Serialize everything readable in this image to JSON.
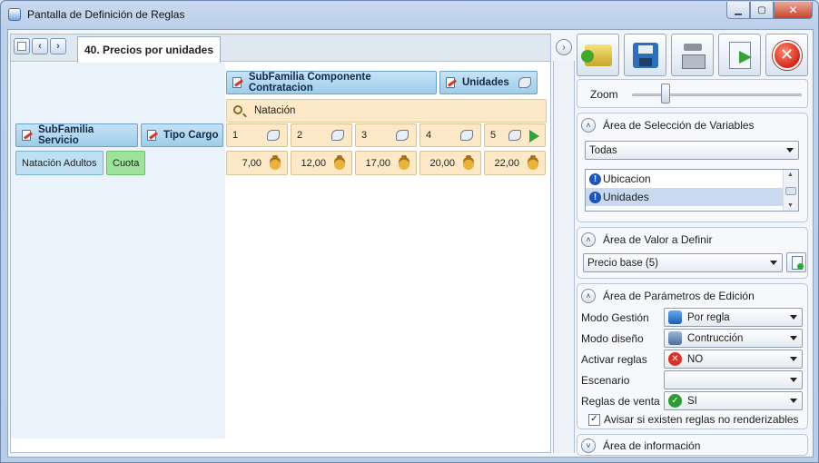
{
  "window": {
    "title": "Pantalla de Definición de Reglas",
    "controls": {
      "minimize": "▁",
      "maximize": "▢",
      "close": "✕"
    }
  },
  "tabs": {
    "nav_prev": "‹",
    "nav_next": "›",
    "active_tab": "40. Precios por unidades"
  },
  "grid": {
    "column_headers": [
      {
        "label": "SubFamilia Componente Contratacion"
      },
      {
        "label": "Unidades"
      }
    ],
    "row_headers": [
      {
        "label": "SubFamilia Servicio"
      },
      {
        "label": "Tipo Cargo"
      }
    ],
    "filter_value": "Natación",
    "units": [
      "1",
      "2",
      "3",
      "4",
      "5"
    ],
    "prices": [
      "7,00",
      "12,00",
      "17,00",
      "20,00",
      "22,00"
    ],
    "row_values": [
      "Natación Adultos",
      "Cuota"
    ]
  },
  "splitter": {
    "collapse_glyph": "›"
  },
  "toolbar": {
    "buttons": [
      "open-icon",
      "save-icon",
      "press-icon",
      "export-icon",
      "cancel-icon"
    ],
    "cancel_glyph": "✕"
  },
  "zoom": {
    "label": "Zoom",
    "level": 0.18
  },
  "variables_section": {
    "title": "Área de Selección de Variables",
    "chevron": "˄",
    "filter_selected": "Todas",
    "items": [
      {
        "label": "Ubicacion",
        "selected": false
      },
      {
        "label": "Unidades",
        "selected": true
      }
    ]
  },
  "value_section": {
    "title": "Área de Valor a Definir",
    "chevron": "˄",
    "selected": "Precio base (5)"
  },
  "params_section": {
    "title": "Área de Parámetros de Edición",
    "chevron": "˄",
    "rows": [
      {
        "label": "Modo Gestión",
        "value": "Por regla",
        "icon": "book-icon"
      },
      {
        "label": "Modo diseño",
        "value": "Contrucción",
        "icon": "gear-icon"
      },
      {
        "label": "Activar reglas",
        "value": "NO",
        "icon": "no-icon"
      },
      {
        "label": "Escenario",
        "value": "",
        "icon": ""
      },
      {
        "label": "Reglas de venta",
        "value": "SI",
        "icon": "yes-icon"
      }
    ],
    "checkbox_label": "Avisar si existen reglas no renderizables",
    "checkbox_checked": true,
    "checkbox_mark": "✓"
  },
  "info_section": {
    "title": "Área de información",
    "chevron": "˅"
  },
  "colors": {
    "header_blue": "#9ecde9",
    "cell_orange": "#fde9c8",
    "row_green": "#9de49a",
    "accent_blue": "#1e55b8"
  }
}
